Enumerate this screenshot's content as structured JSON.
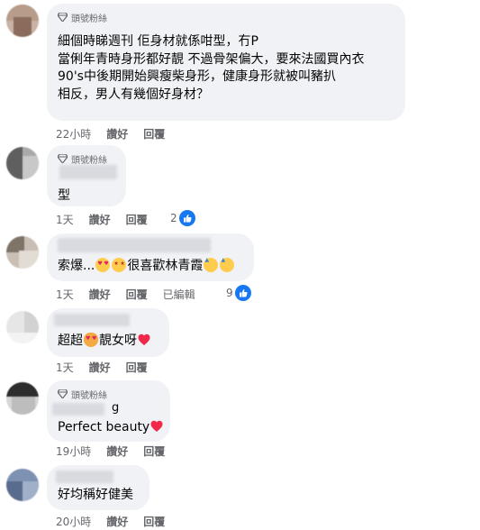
{
  "badge_label": "頭號粉絲",
  "comments": [
    {
      "body": [
        "細個時睇週刊 佢身材就係咁型，冇P",
        "當俐年青時身形都好靚 不過骨架偏大，要來法國買內衣",
        "90's中後期開始興瘦柴身形，健康身形就被叫豬扒",
        "相反，男人有幾個好身材？"
      ],
      "time": "22小時",
      "like": "讚好",
      "reply": "回覆"
    },
    {
      "body": [
        "型"
      ],
      "time": "1天",
      "like": "讚好",
      "reply": "回覆",
      "reaction_count": "2"
    },
    {
      "body_prefix": "索爆...",
      "body_mid": "很喜歡林青霞",
      "time": "1天",
      "like": "讚好",
      "reply": "回覆",
      "edited": "已編輯",
      "reaction_count": "9"
    },
    {
      "body_prefix": "超超",
      "body_mid": "靚女呀",
      "time": "1天",
      "like": "讚好",
      "reply": "回覆"
    },
    {
      "name_fragment": "g",
      "body_prefix": "Perfect beauty",
      "time": "19小時",
      "like": "讚好",
      "reply": "回覆"
    },
    {
      "body": [
        "好均稱好健美"
      ],
      "time": "20小時",
      "like": "讚好",
      "reply": "回覆"
    }
  ],
  "colors": {
    "bubble": "#f0f2f5",
    "secondary_text": "#65676b",
    "like_blue": "#1877f2",
    "heart_red": "#f02849"
  }
}
